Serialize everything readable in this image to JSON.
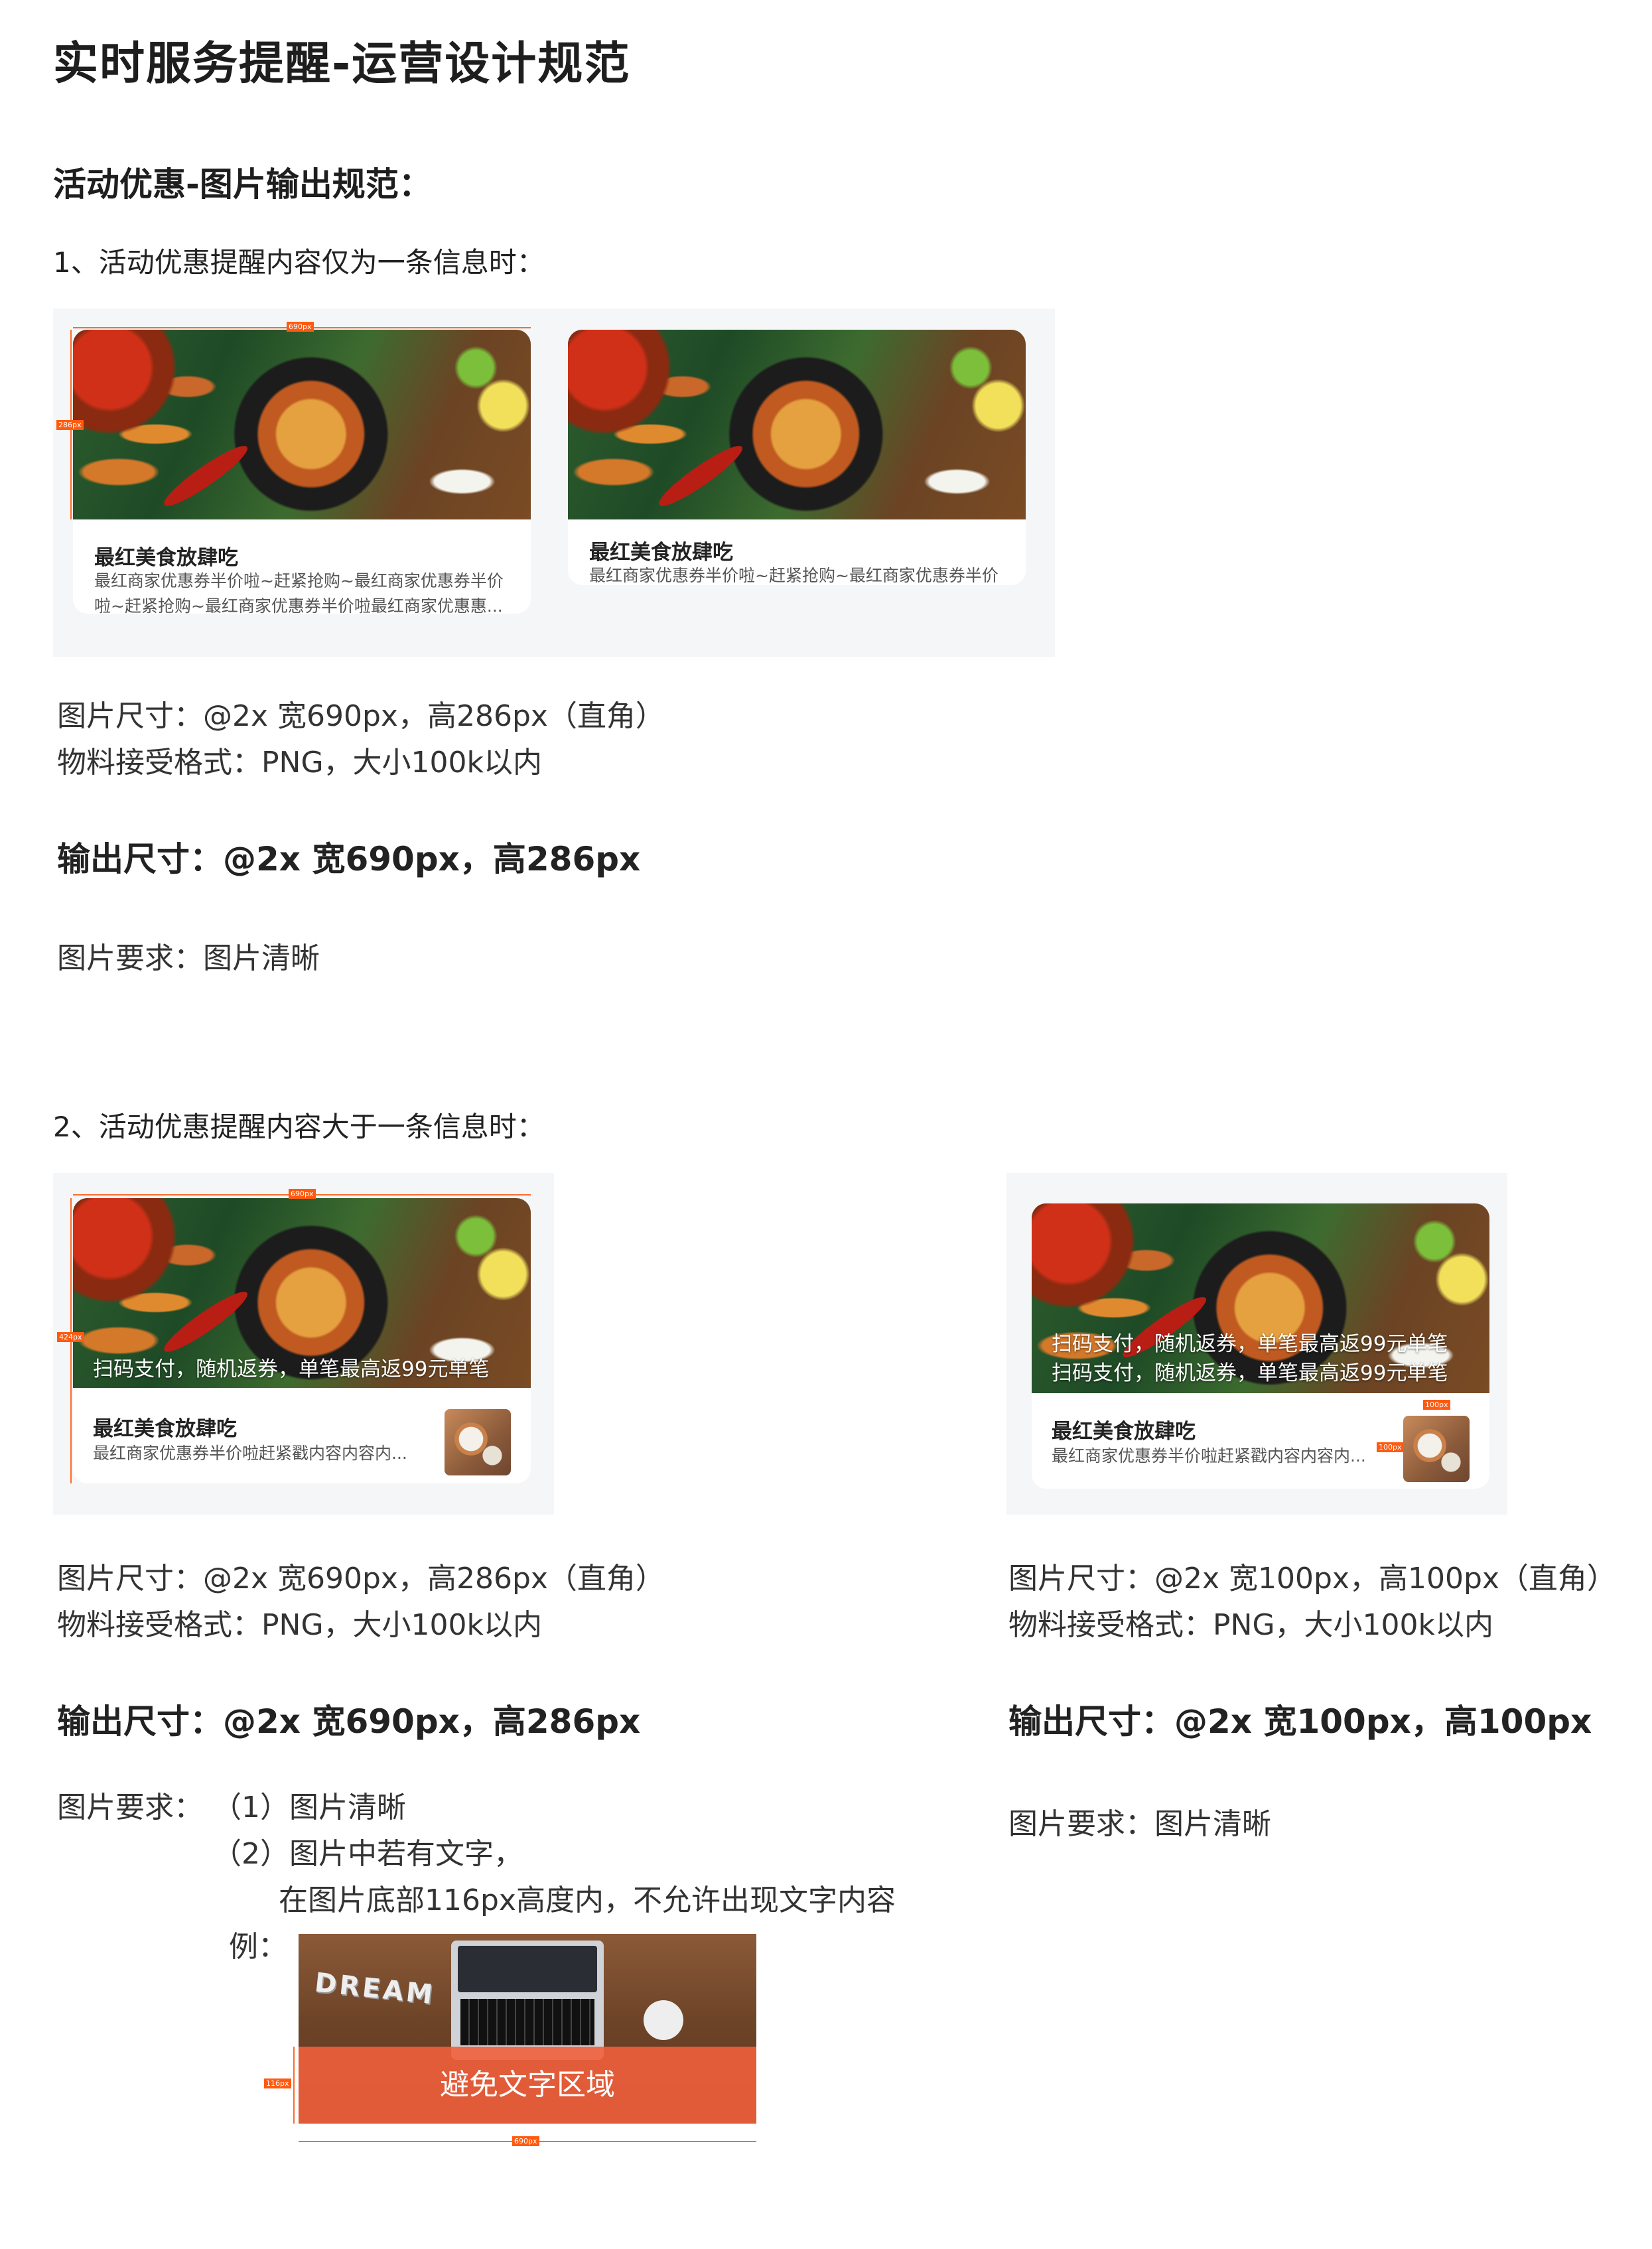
{
  "page": {
    "title": "实时服务提醒-运营设计规范",
    "section_title": "活动优惠-图片输出规范："
  },
  "section1": {
    "heading": "1、活动优惠提醒内容仅为一条信息时：",
    "card_a": {
      "title": "最红美食放肆吃",
      "desc_line1": "最红商家优惠券半价啦~赶紧抢购~最红商家优惠券半价",
      "desc_line2": "啦~赶紧抢购~最红商家优惠券半价啦最红商家优惠惠...",
      "width_tag": "690px",
      "height_tag": "286px"
    },
    "card_b": {
      "title": "最红美食放肆吃",
      "desc_line1": "最红商家优惠券半价啦~赶紧抢购~最红商家优惠券半价"
    },
    "spec_line1": "图片尺寸：@2x 宽690px，高286px（直角）",
    "spec_line2": "物料接受格式：PNG，大小100k以内",
    "output": "输出尺寸：@2x 宽690px，高286px",
    "requirement": "图片要求：图片清晰"
  },
  "section2": {
    "heading": "2、活动优惠提醒内容大于一条信息时：",
    "card_left": {
      "overlay": "扫码支付，随机返券，单笔最高返99元单笔",
      "title": "最红美食放肆吃",
      "desc": "最红商家优惠券半价啦赶紧戳内容内容内...",
      "width_tag": "690px",
      "height_tag": "424px"
    },
    "card_right": {
      "overlay_line1": "扫码支付，随机返券，单笔最高返99元单笔",
      "overlay_line2": "扫码支付，随机返券，单笔最高返99元单笔",
      "title": "最红美食放肆吃",
      "desc": "最红商家优惠券半价啦赶紧戳内容内容内...",
      "thumb_w_tag": "100px",
      "thumb_h_tag": "100px"
    },
    "left": {
      "spec_line1": "图片尺寸：@2x 宽690px，高286px（直角）",
      "spec_line2": "物料接受格式：PNG，大小100k以内",
      "output": "输出尺寸：@2x 宽690px，高286px",
      "req_label": "图片要求：",
      "req_1": "（1）图片清晰",
      "req_2": "（2）图片中若有文字，",
      "req_2b": "在图片底部116px高度内，不允许出现文字内容",
      "example_label": "例：",
      "example_avoid": "避免文字区域",
      "example_dream": "DREAM",
      "example_h_tag": "116px",
      "example_w_tag": "690px"
    },
    "right": {
      "spec_line1": "图片尺寸：@2x 宽100px，高100px（直角）",
      "spec_line2": "物料接受格式：PNG，大小100k以内",
      "output": "输出尺寸：@2x 宽100px，高100px",
      "requirement": "图片要求：图片清晰"
    }
  }
}
